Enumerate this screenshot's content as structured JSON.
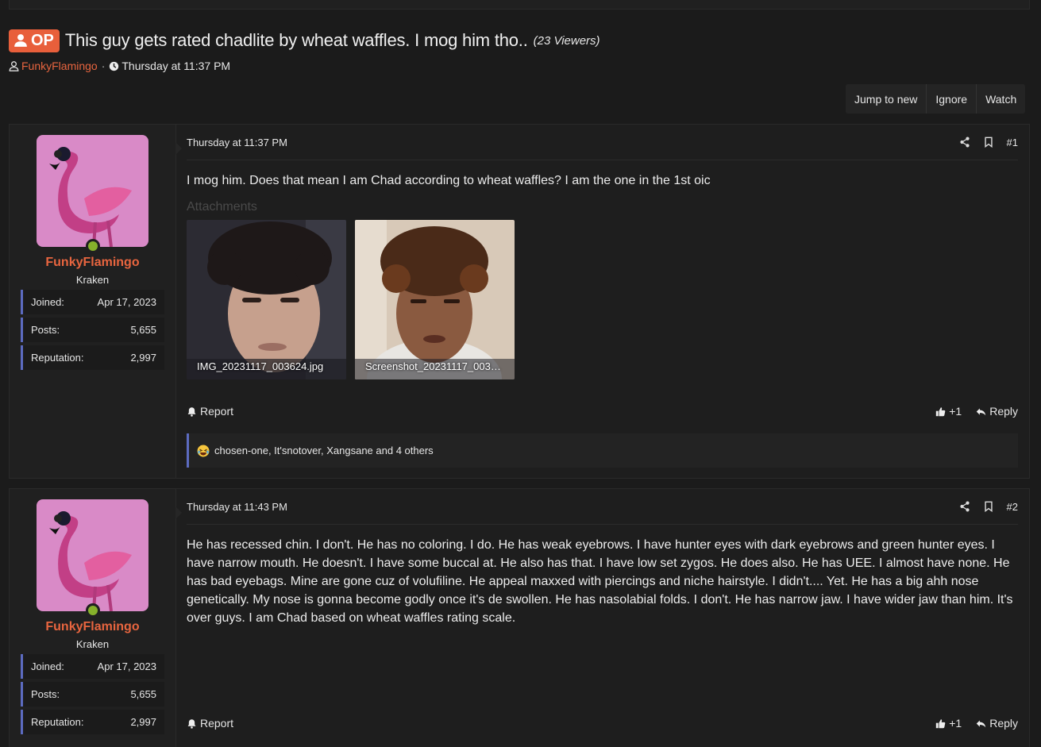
{
  "thread": {
    "op_label": "OP",
    "title": "This guy gets rated chadlite by wheat waffles. I mog him tho..",
    "viewers": "(23 Viewers)",
    "author": "FunkyFlamingo",
    "separator": "·",
    "date": "Thursday at 11:37 PM"
  },
  "thread_actions": {
    "jump": "Jump to new",
    "ignore": "Ignore",
    "watch": "Watch"
  },
  "posts": [
    {
      "user": {
        "name": "FunkyFlamingo",
        "title": "Kraken",
        "joined_label": "Joined:",
        "joined": "Apr 17, 2023",
        "posts_label": "Posts:",
        "posts": "5,655",
        "rep_label": "Reputation:",
        "rep": "2,997"
      },
      "date": "Thursday at 11:37 PM",
      "number": "#1",
      "body": "I mog him. Does that mean I am Chad according to wheat waffles? I am the one in the 1st oic",
      "attachments_label": "Attachments",
      "attachments": [
        "IMG_20231117_003624.jpg",
        "Screenshot_20231117_003…"
      ],
      "report": "Report",
      "like": "+1",
      "reply": "Reply",
      "reactions": "chosen-one, It'snotover, Xangsane and 4 others"
    },
    {
      "user": {
        "name": "FunkyFlamingo",
        "title": "Kraken",
        "joined_label": "Joined:",
        "joined": "Apr 17, 2023",
        "posts_label": "Posts:",
        "posts": "5,655",
        "rep_label": "Reputation:",
        "rep": "2,997"
      },
      "date": "Thursday at 11:43 PM",
      "number": "#2",
      "body": "He has recessed chin. I don't. He has no coloring. I do. He has weak eyebrows. I have hunter eyes with dark eyebrows and green hunter eyes. I have narrow mouth. He doesn't. I have some buccal at. He also has that. I have low set zygos. He does also. He has UEE. I almost have none. He has bad eyebags. Mine are gone cuz of volufiline. He appeal maxxed with piercings and niche hairstyle. I didn't.... Yet. He has a big ahh nose genetically. My nose is gonna become godly once it's de swollen. He has nasolabial folds. I don't. He has narrow jaw. I have wider jaw than him. It's over guys. I am Chad based on wheat waffles rating scale.",
      "report": "Report",
      "like": "+1",
      "reply": "Reply"
    }
  ],
  "colors": {
    "accent": "#e8653f",
    "online": "#86b12b",
    "stat_border": "#5c6bc0",
    "background": "#1b1b1b"
  }
}
